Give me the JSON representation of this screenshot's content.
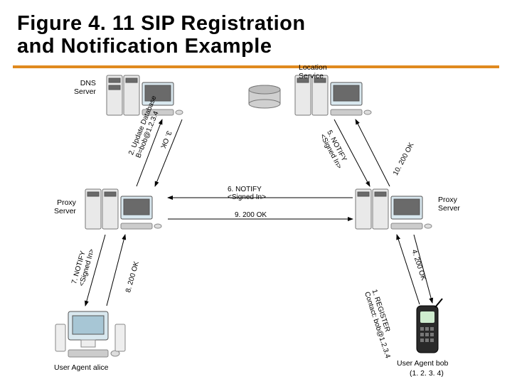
{
  "title_line1": "Figure 4. 11 SIP Registration",
  "title_line2": "and Notification Example",
  "nodes": {
    "dns": "DNS\nServer",
    "location": "Location\nService",
    "proxyL": "Proxy\nServer",
    "proxyR": "Proxy\nServer",
    "alice": "User Agent alice",
    "bob": "User Agent bob",
    "bob_ip": "(1. 2. 3. 4)"
  },
  "messages": {
    "m1": "1. REGISTER\nContact: bob@1.2.3.4",
    "m2": "2. Update Database\nB=bob@1.2.3.4",
    "m3": "3. OK",
    "m4": "4. 200 OK",
    "m5": "5. NOTIFY\n<Signed In>",
    "m6": "6. NOTIFY\n<Signed In>",
    "m7": "7. NOTIFY\n<Signed In>",
    "m8": "8. 200 OK",
    "m9": "9. 200 OK",
    "m10": "10. 200 OK"
  }
}
